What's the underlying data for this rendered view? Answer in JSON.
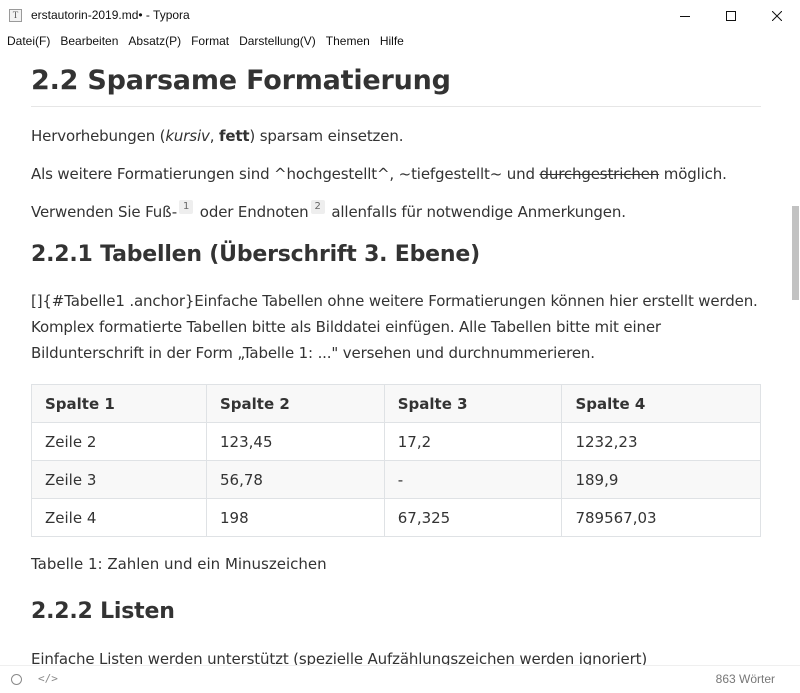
{
  "window": {
    "title": "erstautorin-2019.md• - Typora",
    "app_icon_letter": "T"
  },
  "menu": [
    "Datei(F)",
    "Bearbeiten",
    "Absatz(P)",
    "Format",
    "Darstellung(V)",
    "Themen",
    "Hilfe"
  ],
  "doc": {
    "h2": "2.2 Sparsame Formatierung",
    "p1": {
      "before": "Hervorhebungen (",
      "italic": "kursiv",
      "comma": ", ",
      "bold": "fett",
      "after": ") sparsam einsetzen."
    },
    "p2": {
      "before": "Als weitere Formatierungen sind ^hochgestellt^, ~tiefgestellt~ und ",
      "strike": "durchgestrichen",
      "after": " möglich."
    },
    "p3": {
      "before": "Verwenden Sie Fuß-",
      "fn1": "1",
      "middle": " oder Endnoten",
      "fn2": "2",
      "after": " allenfalls für notwendige Anmerkungen."
    },
    "h3_tables": "2.2.1 Tabellen (Überschrift 3. Ebene)",
    "p4": "[]{#Tabelle1 .anchor}Einfache Tabellen ohne weitere Formatierungen können hier erstellt werden. Komplex formatierte Tabellen bitte als Bilddatei einfügen. Alle Tabellen bitte mit einer Bildunterschrift in der Form „Tabelle 1: ...\" versehen und durchnummerieren.",
    "table": {
      "headers": [
        "Spalte 1",
        "Spalte 2",
        "Spalte 3",
        "Spalte 4"
      ],
      "rows": [
        [
          "Zeile 2",
          "123,45",
          "17,2",
          "1232,23"
        ],
        [
          "Zeile 3",
          "56,78",
          "-",
          "189,9"
        ],
        [
          "Zeile 4",
          "198",
          "67,325",
          "789567,03"
        ]
      ]
    },
    "caption": "Tabelle 1: Zahlen und ein Minuszeichen",
    "h3_lists": "2.2.2 Listen",
    "p5": "Einfache Listen werden unterstützt (spezielle Aufzählungszeichen werden ignoriert)"
  },
  "status": {
    "code_toggle": "</>",
    "word_count": "863 Wörter"
  }
}
